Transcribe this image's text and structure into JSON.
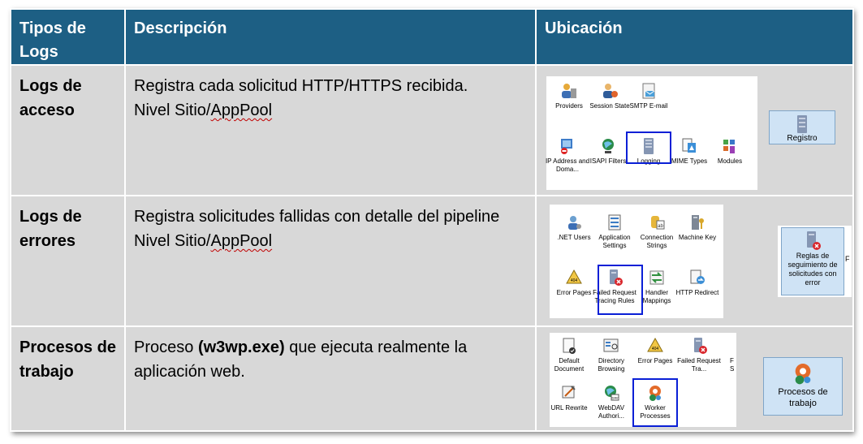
{
  "headers": {
    "type": "Tipos de Logs",
    "description": "Descripción",
    "location": "Ubicación"
  },
  "rows": [
    {
      "type": "Logs de acceso",
      "desc_line1": "Registra cada solicitud HTTP/HTTPS recibida.",
      "desc_line2": "Nivel Sitio/",
      "desc_squiggle": "AppPool",
      "icons": [
        "Providers",
        "Session State",
        "SMTP E-mail",
        "IP Address and Doma...",
        "ISAPI Filters",
        "Logging",
        "MIME Types",
        "Modules"
      ],
      "side_label": "Registro"
    },
    {
      "type": "Logs de errores",
      "desc_line1": "Registra solicitudes fallidas con detalle del pipeline",
      "desc_line2": "Nivel Sitio/",
      "desc_squiggle": "AppPool",
      "icons": [
        ".NET Users",
        "Application Settings",
        "Connection Strings",
        "Machine Key",
        "Error Pages",
        "Failed Request Tracing Rules",
        "Handler Mappings",
        "HTTP Redirect"
      ],
      "side_label": "Reglas de seguimiento de solicitudes con error",
      "side_edge": "F"
    },
    {
      "type": "Procesos de trabajo",
      "desc_pre": "Proceso ",
      "desc_bold": "(w3wp.exe)",
      "desc_post": " que ejecuta realmente la aplicación web.",
      "icons": [
        "Default Document",
        "Directory Browsing",
        "Error Pages",
        "Failed Request Tra...",
        "URL Rewrite",
        "WebDAV Authori...",
        "Worker Processes"
      ],
      "edge_letters": "F S",
      "side_label": "Procesos de trabajo"
    }
  ],
  "icon_badges": {
    "error_pages": "404",
    "webdav": "DAV"
  },
  "colors": {
    "header_bg": "#1d5f84",
    "row_bg": "#d8d8d8",
    "selection": "#0a1fd6",
    "side_box": "#cfe3f5"
  }
}
